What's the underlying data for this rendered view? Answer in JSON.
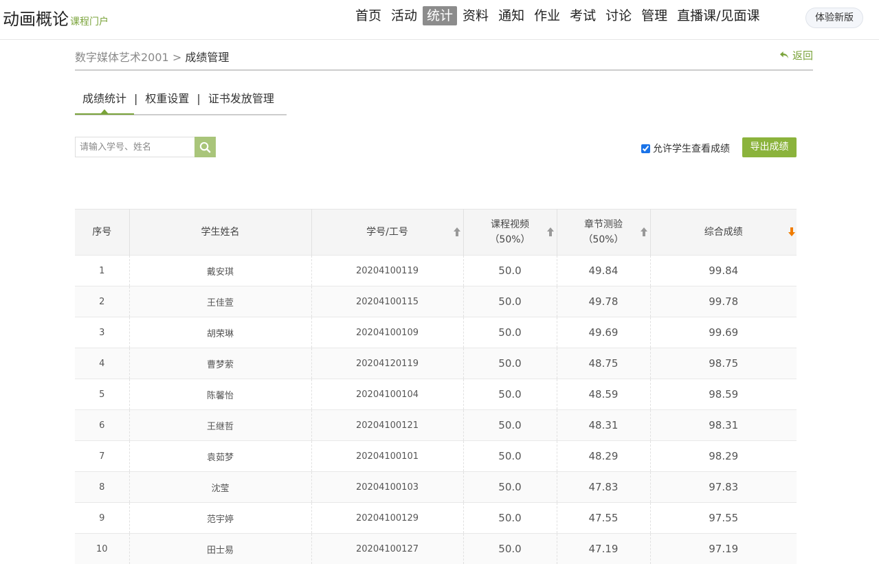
{
  "header": {
    "title": "动画概论",
    "subtitle": "课程门户",
    "nav": [
      {
        "label": "首页",
        "active": false
      },
      {
        "label": "活动",
        "active": false
      },
      {
        "label": "统计",
        "active": true
      },
      {
        "label": "资料",
        "active": false
      },
      {
        "label": "通知",
        "active": false
      },
      {
        "label": "作业",
        "active": false
      },
      {
        "label": "考试",
        "active": false
      },
      {
        "label": "讨论",
        "active": false
      },
      {
        "label": "管理",
        "active": false
      },
      {
        "label": "直播课/见面课",
        "active": false
      }
    ],
    "new_version": "体验新版"
  },
  "breadcrumb": {
    "course": "数字媒体艺术2001",
    "separator": ">",
    "current": "成绩管理",
    "back": "返回"
  },
  "tabs": [
    {
      "label": "成绩统计",
      "active": true
    },
    {
      "label": "权重设置",
      "active": false
    },
    {
      "label": "证书发放管理",
      "active": false
    }
  ],
  "tab_separator": "|",
  "search": {
    "placeholder": "请输入学号、姓名"
  },
  "allow_view": {
    "label": "允许学生查看成绩",
    "checked": true
  },
  "export_label": "导出成绩",
  "table": {
    "headers": {
      "index": "序号",
      "name": "学生姓名",
      "id": "学号/工号",
      "video_line1": "课程视频",
      "video_line2": "（50%）",
      "quiz_line1": "章节测验",
      "quiz_line2": "（50%）",
      "total": "综合成绩"
    },
    "rows": [
      {
        "no": "1",
        "name": "戴安琪",
        "id": "20204100119",
        "video": "50.0",
        "quiz": "49.84",
        "total": "99.84"
      },
      {
        "no": "2",
        "name": "王佳萱",
        "id": "20204100115",
        "video": "50.0",
        "quiz": "49.78",
        "total": "99.78"
      },
      {
        "no": "3",
        "name": "胡荣琳",
        "id": "20204100109",
        "video": "50.0",
        "quiz": "49.69",
        "total": "99.69"
      },
      {
        "no": "4",
        "name": "曹梦萦",
        "id": "20204120119",
        "video": "50.0",
        "quiz": "48.75",
        "total": "98.75"
      },
      {
        "no": "5",
        "name": "陈馨怡",
        "id": "20204100104",
        "video": "50.0",
        "quiz": "48.59",
        "total": "98.59"
      },
      {
        "no": "6",
        "name": "王继哲",
        "id": "20204100121",
        "video": "50.0",
        "quiz": "48.31",
        "total": "98.31"
      },
      {
        "no": "7",
        "name": "袁茹梦",
        "id": "20204100101",
        "video": "50.0",
        "quiz": "48.29",
        "total": "98.29"
      },
      {
        "no": "8",
        "name": "沈莹",
        "id": "20204100103",
        "video": "50.0",
        "quiz": "47.83",
        "total": "97.83"
      },
      {
        "no": "9",
        "name": "范宇婷",
        "id": "20204100129",
        "video": "50.0",
        "quiz": "47.55",
        "total": "97.55"
      },
      {
        "no": "10",
        "name": "田士易",
        "id": "20204100127",
        "video": "50.0",
        "quiz": "47.19",
        "total": "97.19"
      }
    ]
  },
  "colors": {
    "accent": "#8bb33c",
    "sort_active": "#f07c00",
    "sort_inactive": "#999999"
  }
}
